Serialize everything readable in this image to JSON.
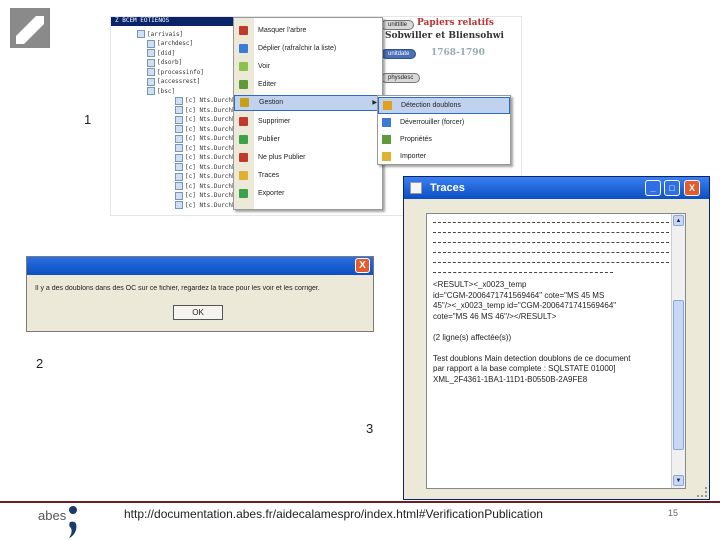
{
  "slide": {
    "labels": {
      "step1": "1",
      "step2": "2",
      "step3": "3"
    },
    "footer_url": "http://documentation.abes.fr/aidecalamespro/index.html#VerificationPublication",
    "page_number": "15",
    "logo_text": "abes"
  },
  "tree": {
    "title": "Ž BCEM EOTIENOS",
    "items": [
      "[arrivais]",
      "[archdesc]",
      "[did]",
      "[dsorb]",
      "[processinfo]",
      "[accessrest]",
      "[bsc]",
      "[c] Nts.Durchhe",
      "[c] Nts.Durchhe",
      "[c] Nts.Durchhe",
      "[c] Nts.Durchhe",
      "[c] Nts.Durchhe",
      "[c] Nts.Durchhe",
      "[c] Nts.Durchhe",
      "[c] Nts.Durchhe",
      "[c] Nts.Durchhe",
      "[c] Nts.Durchhe",
      "[c] Nts.Durchhe",
      "[c] Nts.Durchhe"
    ]
  },
  "context_menu": {
    "items": [
      {
        "label": "Masquer l'arbre",
        "icon": "close-red-icon",
        "color": "#c0392b"
      },
      {
        "label": "Déplier (rafraîchir la liste)",
        "icon": "expand-icon",
        "color": "#3a7bd5"
      },
      {
        "label": "Voir",
        "icon": "view-icon",
        "color": "#8bc34a"
      },
      {
        "label": "Editer",
        "icon": "edit-icon",
        "color": "#5d9b3a"
      },
      {
        "label": "Gestion",
        "icon": "manage-icon",
        "color": "#c8a017"
      },
      {
        "label": "Supprimer",
        "icon": "delete-icon",
        "color": "#c0392b"
      },
      {
        "label": "Publier",
        "icon": "publish-icon",
        "color": "#3aa34a"
      },
      {
        "label": "Ne plus Publier",
        "icon": "unpublish-icon",
        "color": "#c0392b"
      },
      {
        "label": "Traces",
        "icon": "traces-icon",
        "color": "#e0b030"
      },
      {
        "label": "Exporter",
        "icon": "export-icon",
        "color": "#3aa34a"
      }
    ],
    "active_index": 4
  },
  "submenu": {
    "items": [
      {
        "label": "Détection doublons",
        "icon": "detect-icon",
        "color": "#e0a020"
      },
      {
        "label": "Déverrouiller (forcer)",
        "icon": "unlock-icon",
        "color": "#3a7bd5"
      },
      {
        "label": "Propriétés",
        "icon": "properties-icon",
        "color": "#5d9b3a"
      },
      {
        "label": "Importer",
        "icon": "import-icon",
        "color": "#e0b030"
      }
    ],
    "active_index": 0
  },
  "document_preview": {
    "tag1": "unittitle",
    "title_line1": "Papiers relatifs",
    "title_line2": "Sobwiller et Bliensohwi",
    "tag2": "unitdate",
    "date": "1768-1790",
    "tag3": "physdesc"
  },
  "dialog": {
    "message": "Il y a des doublons dans des OC sur ce fichier, regardez la trace pour les voir et les corriger.",
    "ok_label": "OK",
    "close_label": "X"
  },
  "traces_window": {
    "title": "Traces",
    "buttons": {
      "minimize": "_",
      "maximize": "□",
      "close": "X"
    },
    "lines": [
      "<RESULT><_x0023_temp",
      "id=\"CGM-2006471741569464\" cote=\"MS 45 MS",
      "45\"/><_x0023_temp id=\"CGM-2006471741569464\"",
      "cote=\"MS 46 MS 46\"/></RESULT>",
      "",
      "(2 ligne(s) affectée(s))",
      "",
      "Test doublons Main detection doublons de ce document",
      "par rapport a la base complete : SQLSTATE 01000]",
      "XML_2F4361-1BA1-11D1-B0550B-2A9FE8"
    ]
  },
  "colors": {
    "footer_line": "#6b1e24",
    "title_bar": "#0a4fc4",
    "menu_highlight": "#c1d2ee"
  }
}
